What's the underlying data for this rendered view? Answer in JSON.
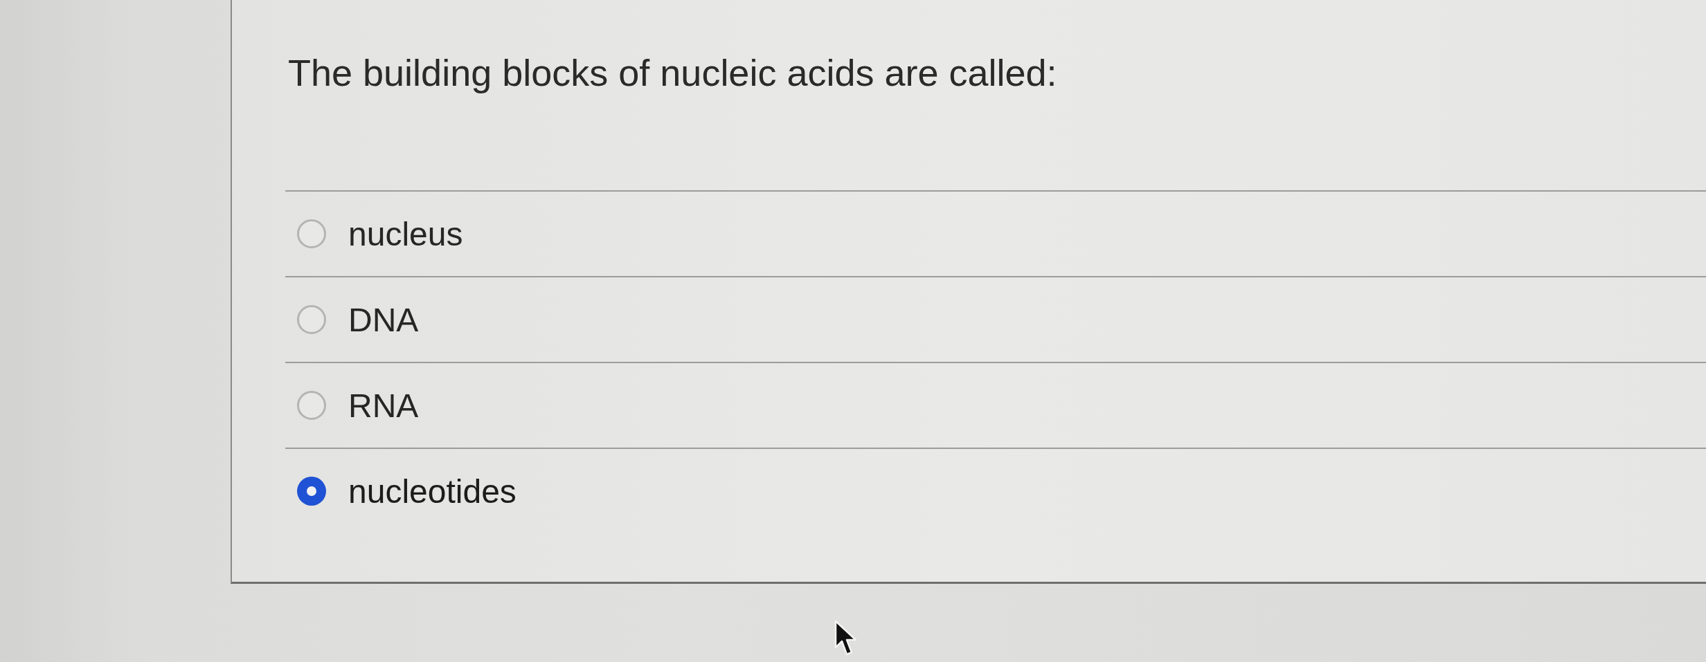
{
  "question": {
    "text": "The building blocks of nucleic acids are called:"
  },
  "options": [
    {
      "label": "nucleus",
      "selected": false
    },
    {
      "label": "DNA",
      "selected": false
    },
    {
      "label": "RNA",
      "selected": false
    },
    {
      "label": "nucleotides",
      "selected": true
    }
  ]
}
